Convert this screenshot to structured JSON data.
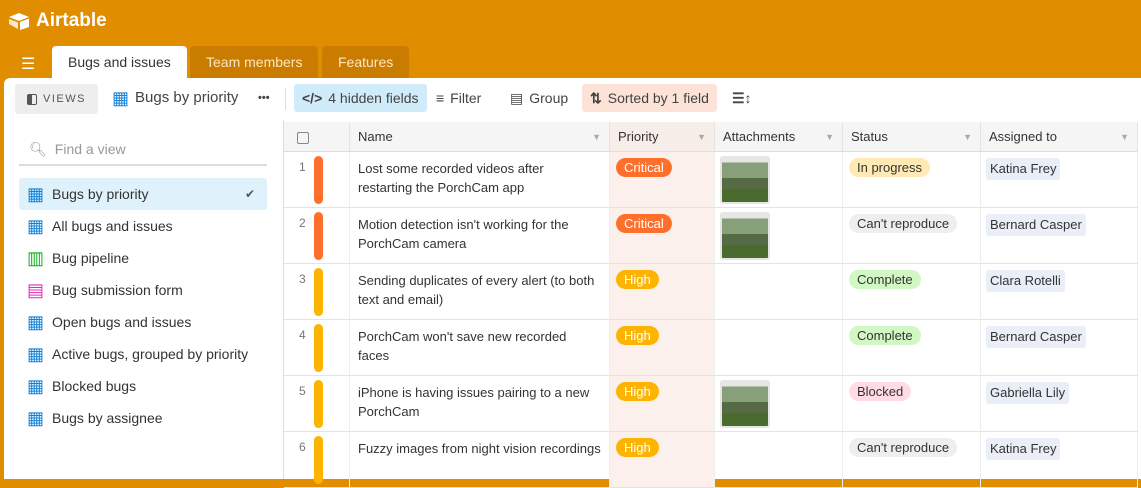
{
  "app": {
    "name": "Airtable"
  },
  "tabs": [
    {
      "label": "Bugs and issues",
      "active": true
    },
    {
      "label": "Team members"
    },
    {
      "label": "Features"
    }
  ],
  "toolbar": {
    "views_label": "VIEWS",
    "current_view": "Bugs by priority",
    "more": "•••",
    "hidden_fields": "4 hidden fields",
    "filter": "Filter",
    "group": "Group",
    "sort": "Sorted by 1 field"
  },
  "sidebar": {
    "search_placeholder": "Find a view",
    "items": [
      {
        "label": "Bugs by priority",
        "type": "grid",
        "selected": true
      },
      {
        "label": "All bugs and issues",
        "type": "grid"
      },
      {
        "label": "Bug pipeline",
        "type": "kanban"
      },
      {
        "label": "Bug submission form",
        "type": "form"
      },
      {
        "label": "Open bugs and issues",
        "type": "grid"
      },
      {
        "label": "Active bugs, grouped by priority",
        "type": "grid"
      },
      {
        "label": "Blocked bugs",
        "type": "grid"
      },
      {
        "label": "Bugs by assignee",
        "type": "grid"
      }
    ]
  },
  "columns": [
    "Name",
    "Priority",
    "Attachments",
    "Status",
    "Assigned to"
  ],
  "colors": {
    "Critical": "#FF6F2C",
    "High": "#FCB400",
    "In progress": "#FFEAB6",
    "Can't reproduce": "#EEEEEE",
    "Complete": "#D1F7C4",
    "Blocked": "#FFDCE5"
  },
  "rows": [
    {
      "num": "1",
      "name": "Lost some recorded videos after restarting the PorchCam app",
      "priority": "Critical",
      "attachment": true,
      "status": "In progress",
      "assignee": "Katina Frey"
    },
    {
      "num": "2",
      "name": "Motion detection isn't working for the PorchCam camera",
      "priority": "Critical",
      "attachment": true,
      "status": "Can't reproduce",
      "assignee": "Bernard Casper"
    },
    {
      "num": "3",
      "name": "Sending duplicates of every alert (to both text and email)",
      "priority": "High",
      "attachment": false,
      "status": "Complete",
      "assignee": "Clara Rotelli"
    },
    {
      "num": "4",
      "name": "PorchCam won't save new recorded faces",
      "priority": "High",
      "attachment": false,
      "status": "Complete",
      "assignee": "Bernard Casper"
    },
    {
      "num": "5",
      "name": "iPhone is having issues pairing to a new PorchCam",
      "priority": "High",
      "attachment": true,
      "status": "Blocked",
      "assignee": "Gabriella Lily"
    },
    {
      "num": "6",
      "name": "Fuzzy images from night vision recordings",
      "priority": "High",
      "attachment": false,
      "status": "Can't reproduce",
      "assignee": "Katina Frey"
    }
  ]
}
